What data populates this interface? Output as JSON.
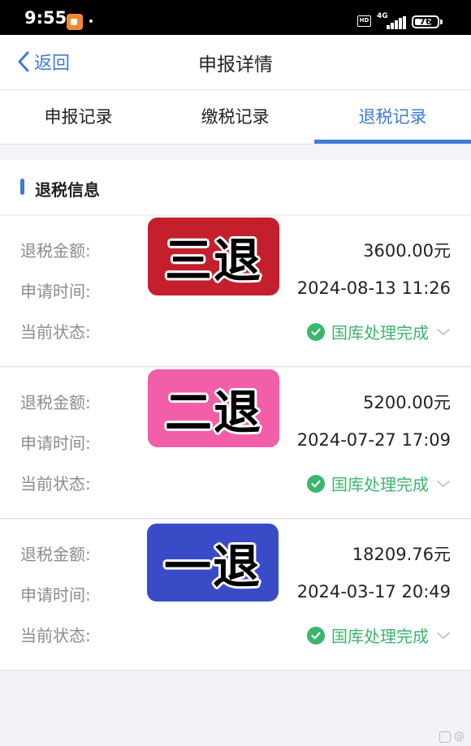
{
  "status_bar": {
    "time": "9:55",
    "hd": "HD",
    "network": "4G",
    "battery": "76",
    "battery_level": 0.76
  },
  "nav": {
    "back_label": "返回",
    "title": "申报详情"
  },
  "tabs": [
    {
      "label": "申报记录",
      "active": false
    },
    {
      "label": "缴税记录",
      "active": false
    },
    {
      "label": "退税记录",
      "active": true
    }
  ],
  "section": {
    "title": "退税信息"
  },
  "records": [
    {
      "amount_label": "退税金额:",
      "amount": "3600.00元",
      "time_label": "申请时间:",
      "time": "2024-08-13 11:26",
      "status_label": "当前状态:",
      "status": "国库处理完成",
      "sticker_text": "三退",
      "sticker_color": "#c41f2c"
    },
    {
      "amount_label": "退税金额:",
      "amount": "5200.00元",
      "time_label": "申请时间:",
      "time": "2024-07-27 17:09",
      "status_label": "当前状态:",
      "status": "国库处理完成",
      "sticker_text": "二退",
      "sticker_color": "#f25ea8"
    },
    {
      "amount_label": "退税金额:",
      "amount": "18209.76元",
      "time_label": "申请时间:",
      "time": "2024-03-17 20:49",
      "status_label": "当前状态:",
      "status": "国库处理完成",
      "sticker_text": "一退",
      "sticker_color": "#3a4bc7"
    }
  ],
  "watermark": "@"
}
